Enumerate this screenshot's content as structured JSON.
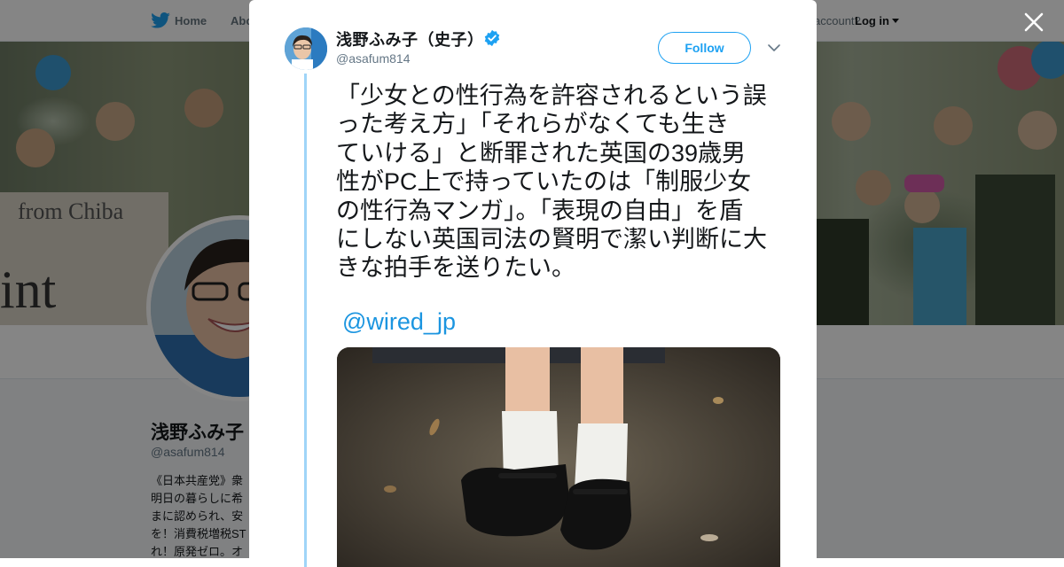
{
  "header": {
    "home_label": "Home",
    "about_label": "Abo",
    "account_prompt": "account?",
    "login_label": "Log in"
  },
  "profile": {
    "name": "浅野ふみ子",
    "handle": "@asafum814",
    "bio": "《日本共産党》衆\n明日の暮らしに希\nまに認められ、安\nを！消費税増税ST\nれ！原発ゼロ。オ"
  },
  "tweet": {
    "author_name": "浅野ふみ子（史子）",
    "author_handle": "@asafum814",
    "follow_label": "Follow",
    "text": "「少女との性行為を許容されるという誤\nった考え方」「それらがなくても生き\nていける」と断罪された英国の39歳男\n性がPC上で持っていたのは「制服少女\nの性行為マンガ」。「表現の自由」を盾\nにしない英国司法の賢明で潔い判断に大\nきな拍手を送りたい。",
    "mention": "@wired_jp"
  },
  "icons": {
    "bird": "twitter-bird-icon",
    "verified": "verified-badge-icon",
    "chevron": "chevron-down-icon",
    "close": "close-icon"
  },
  "colors": {
    "brand": "#1da1f2",
    "link": "#1b95e0",
    "thread_line": "#9fd5f8",
    "overlay": "rgba(0,0,0,0.48)"
  }
}
